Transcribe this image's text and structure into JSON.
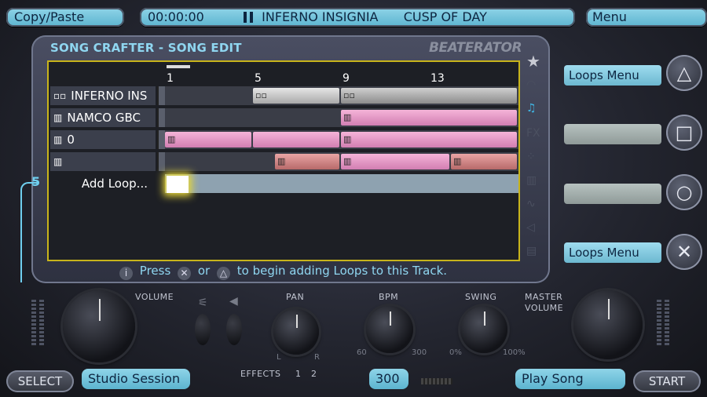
{
  "top": {
    "copy_paste": "Copy/Paste",
    "time": "00:00:00",
    "song_title": "INFERNO INSIGNIA",
    "song_sub": "CUSP OF DAY",
    "menu": "Menu"
  },
  "panel": {
    "title": "SONG CRAFTER - SONG EDIT",
    "brand": "BEATERATOR"
  },
  "ruler": [
    "1",
    "5",
    "9",
    "13"
  ],
  "tracks": [
    {
      "icon": "▫▫",
      "label": "INFERNO INS"
    },
    {
      "icon": "▥",
      "label": "NAMCO GBC"
    },
    {
      "icon": "▥",
      "label": "0"
    },
    {
      "icon": "▥",
      "label": ""
    }
  ],
  "add_loop": "Add Loop...",
  "track_number": "5",
  "hint": {
    "pre": "Press",
    "or": "or",
    "post": "to begin adding Loops to this Track.",
    "x_symbol": "✕",
    "tri_symbol": "△"
  },
  "side": {
    "loops_menu_top": "Loops Menu",
    "loops_menu_bottom": "Loops Menu",
    "triangle": "△",
    "square": "□",
    "circle": "○",
    "cross": "✕"
  },
  "bottom": {
    "volume": "VOLUME",
    "pan": "PAN",
    "pan_l": "L",
    "pan_r": "R",
    "effects": "EFFECTS",
    "effects_1": "1",
    "effects_2": "2",
    "bpm": "BPM",
    "bpm_min": "60",
    "bpm_max": "300",
    "swing": "SWING",
    "swing_min": "0%",
    "swing_max": "100%",
    "master_volume_1": "MASTER",
    "master_volume_2": "VOLUME",
    "select": "SELECT",
    "studio_session": "Studio Session",
    "bpm_value": "300",
    "play_song": "Play Song",
    "start": "START"
  }
}
